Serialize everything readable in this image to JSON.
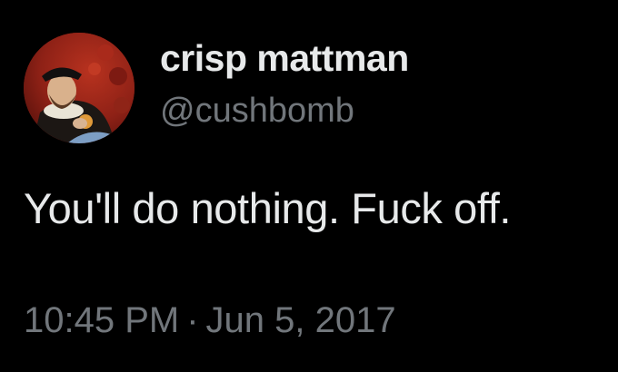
{
  "tweet": {
    "author": {
      "display_name": "crisp mattman",
      "handle": "@cushbomb",
      "avatar_icon": "profile-photo-avatar"
    },
    "text": "You'll do nothing. Fuck off.",
    "timestamp": {
      "time": "10:45 PM",
      "separator": "·",
      "date": "Jun 5, 2017"
    }
  },
  "colors": {
    "background": "#000000",
    "primary_text": "#e7e9ea",
    "secondary_text": "#71767b"
  }
}
